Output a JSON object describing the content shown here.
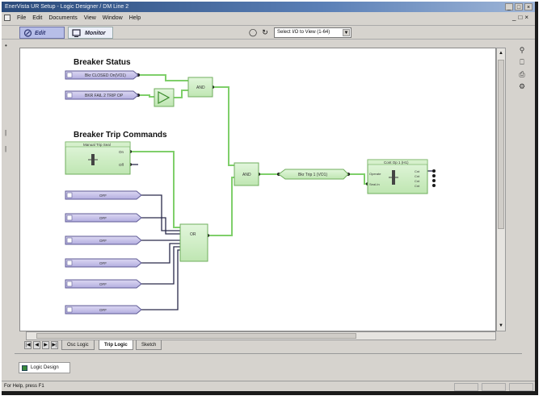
{
  "window": {
    "title": "EnerVista UR Setup - Logic Designer / DM Line 2",
    "buttons": [
      "_",
      "□",
      "×"
    ]
  },
  "menu": {
    "items": [
      "File",
      "Edit",
      "Documents",
      "View",
      "Window",
      "Help"
    ]
  },
  "toolbar": {
    "edit_label": "Edit",
    "monitor_label": "Monitor",
    "view_select_value": "Select I/O to View (1-64)"
  },
  "diagram": {
    "breaker_status_title": "Breaker Status",
    "trip_commands_title": "Breaker Trip Commands",
    "status_inputs": [
      "Bkr CLOSED On(VO1)",
      "BKR FAIL 2 TRIP OP"
    ],
    "gate_and_top": "AND",
    "gate_and_mid": "AND",
    "gate_or": "OR",
    "latch_block_title": "Manual Trip Seal",
    "latch_ports": [
      "On",
      "Off"
    ],
    "off_inputs": [
      "OFF",
      "OFF",
      "OFF",
      "OFF",
      "OFF",
      "OFF"
    ],
    "virtual_output": "Bkr Trip 1 (VO1)",
    "trip_block_title": "Cont Op 1 (H1)",
    "trip_block_ports": [
      "Operate",
      "Seal-In"
    ],
    "trip_block_outputs": [
      "Cnt",
      "Cnt",
      "Cnt",
      "Cnt"
    ]
  },
  "tabs": {
    "items": [
      "Osc Logic",
      "Trip Logic",
      "Sketch"
    ],
    "active_index": 1
  },
  "bottom": {
    "task_button": "Logic Design"
  },
  "status": {
    "text": "For Help, press F1"
  },
  "colors": {
    "edit_mode_bg": "#b7bee8",
    "input_block": "#c7c3e8",
    "logic_block": "#cfeec6",
    "wire_green": "#7fcf6a",
    "wire_dark": "#2a2a4a"
  }
}
